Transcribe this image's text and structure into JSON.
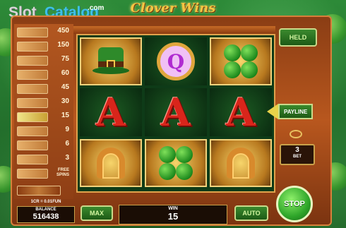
{
  "logo": {
    "part1": "Slot",
    "part2": "Catalog",
    "suffix": ".com"
  },
  "game": {
    "title": "Clover Wins"
  },
  "paytable": [
    {
      "icon": "hat-icon",
      "value": "450"
    },
    {
      "icon": "coin-icon",
      "value": "150"
    },
    {
      "icon": "horseshoe-icon",
      "value": "75"
    },
    {
      "icon": "clover-icon",
      "value": "60"
    },
    {
      "icon": "k-icon",
      "value": "45"
    },
    {
      "icon": "q-icon",
      "value": "30"
    },
    {
      "icon": "a-icon",
      "value": "15"
    },
    {
      "icon": "k-small-icon",
      "value": "9"
    },
    {
      "icon": "q-small-icon",
      "value": "6"
    },
    {
      "icon": "j-small-icon",
      "value": "3"
    },
    {
      "icon": "scatter-icon",
      "value": "FREE SPINS"
    }
  ],
  "reels": [
    [
      "hat",
      "A",
      "horseshoe"
    ],
    [
      "Q",
      "A",
      "clover"
    ],
    [
      "clover",
      "A",
      "horseshoe"
    ]
  ],
  "controls": {
    "held": "HELD",
    "payline": "PAYLINE",
    "bet_value": "3",
    "bet_label": "BET",
    "credit": "1CR = 0.01FUN",
    "balance_label": "BALANCE",
    "balance_value": "516438",
    "max": "MAX",
    "win_label": "WIN",
    "win_value": "15",
    "auto": "AUTO",
    "stop": "STOP"
  }
}
